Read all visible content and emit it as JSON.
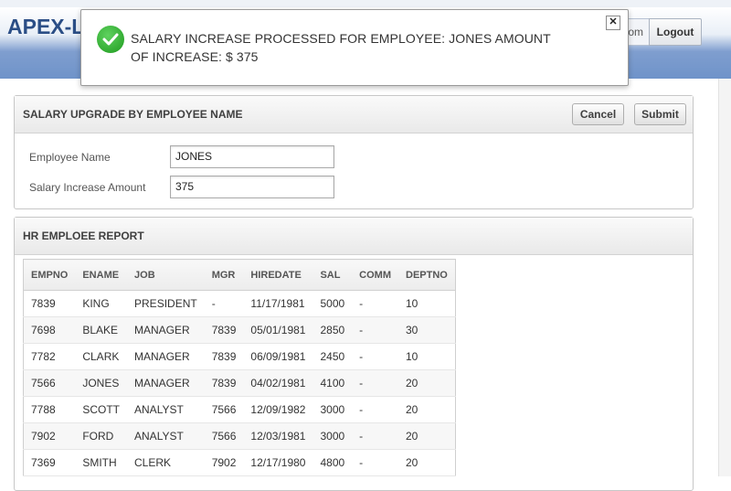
{
  "header": {
    "app_title": "APEX-L",
    "user_label": "om",
    "logout_label": "Logout"
  },
  "notification": {
    "message": "SALARY INCREASE PROCESSED FOR EMPLOYEE: JONES AMOUNT OF INCREASE: $ 375",
    "close_icon": "close-icon",
    "status_icon": "check-icon",
    "accent": "#2aa52a"
  },
  "salary_region": {
    "title": "SALARY UPGRADE BY EMPLOYEE NAME",
    "cancel_label": "Cancel",
    "submit_label": "Submit",
    "fields": {
      "employee_name_label": "Employee Name",
      "employee_name_value": "JONES",
      "amount_label": "Salary Increase Amount",
      "amount_value": "375"
    }
  },
  "report_region": {
    "title": "HR EMPLOEE REPORT",
    "columns": [
      "EMPNO",
      "ENAME",
      "JOB",
      "MGR",
      "HIREDATE",
      "SAL",
      "COMM",
      "DEPTNO"
    ],
    "rows": [
      [
        "7839",
        "KING",
        "PRESIDENT",
        "-",
        "11/17/1981",
        "5000",
        "-",
        "10"
      ],
      [
        "7698",
        "BLAKE",
        "MANAGER",
        "7839",
        "05/01/1981",
        "2850",
        "-",
        "30"
      ],
      [
        "7782",
        "CLARK",
        "MANAGER",
        "7839",
        "06/09/1981",
        "2450",
        "-",
        "10"
      ],
      [
        "7566",
        "JONES",
        "MANAGER",
        "7839",
        "04/02/1981",
        "4100",
        "-",
        "20"
      ],
      [
        "7788",
        "SCOTT",
        "ANALYST",
        "7566",
        "12/09/1982",
        "3000",
        "-",
        "20"
      ],
      [
        "7902",
        "FORD",
        "ANALYST",
        "7566",
        "12/03/1981",
        "3000",
        "-",
        "20"
      ],
      [
        "7369",
        "SMITH",
        "CLERK",
        "7902",
        "12/17/1980",
        "4800",
        "-",
        "20"
      ]
    ]
  }
}
